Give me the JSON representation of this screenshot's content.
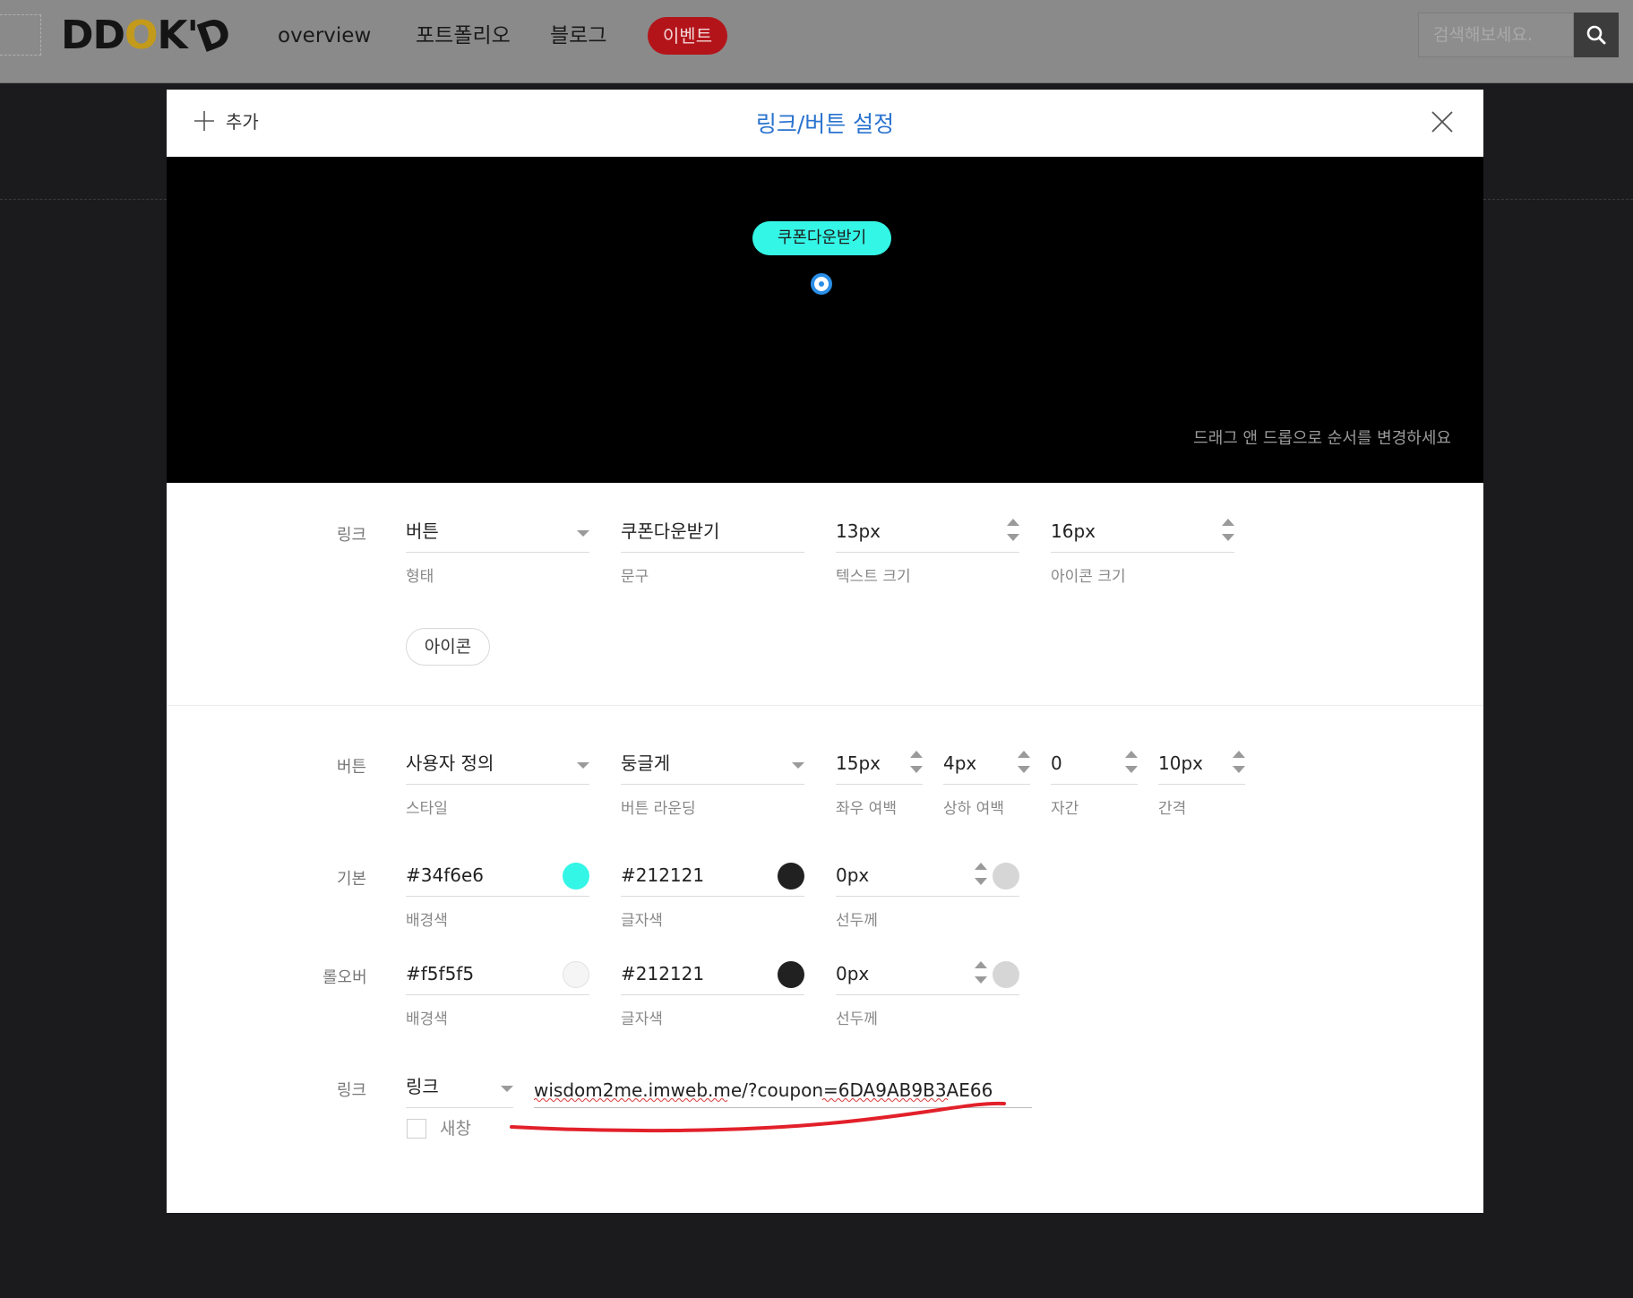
{
  "nav": {
    "logo_left": "DD",
    "logo_o": "O",
    "logo_right": "K'",
    "logo_tail": "D",
    "items": [
      "overview",
      "포트폴리오",
      "블로그"
    ],
    "badge": "이벤트",
    "search_placeholder": "검색해보세요."
  },
  "modal": {
    "add_label": "추가",
    "title": "링크/버튼 설정",
    "preview_button_text": "쿠폰다운받기",
    "preview_hint": "드래그 앤 드롭으로 순서를 변경하세요",
    "preview_button_bg": "#34f6e6"
  },
  "form": {
    "link_row": {
      "label": "링크",
      "type_value": "버튼",
      "type_label": "형태",
      "text_value": "쿠폰다운받기",
      "text_label": "문구",
      "text_size_value": "13px",
      "text_size_label": "텍스트 크기",
      "icon_size_value": "16px",
      "icon_size_label": "아이콘 크기",
      "icon_button": "아이콘"
    },
    "button_row": {
      "label": "버튼",
      "style_value": "사용자 정의",
      "style_label": "스타일",
      "rounding_value": "둥글게",
      "rounding_label": "버튼 라운딩",
      "h_padding_value": "15px",
      "h_padding_label": "좌우 여백",
      "v_padding_value": "4px",
      "v_padding_label": "상하 여백",
      "letter_spacing_value": "0",
      "letter_spacing_label": "자간",
      "gap_value": "10px",
      "gap_label": "간격"
    },
    "default_row": {
      "label": "기본",
      "bg_value": "#34f6e6",
      "bg_label": "배경색",
      "text_color_value": "#212121",
      "text_color_label": "글자색",
      "border_value": "0px",
      "border_label": "선두께",
      "bg_swatch": "#34f6e6",
      "text_swatch": "#212121",
      "border_swatch": "#d6d6d6"
    },
    "hover_row": {
      "label": "롤오버",
      "bg_value": "#f5f5f5",
      "bg_label": "배경색",
      "text_color_value": "#212121",
      "text_color_label": "글자색",
      "border_value": "0px",
      "border_label": "선두께",
      "bg_swatch": "#f5f5f5",
      "text_swatch": "#212121",
      "border_swatch": "#d6d6d6"
    },
    "link_target_row": {
      "label": "링크",
      "type_value": "링크",
      "url_value": "wisdom2me.imweb.me/?coupon=6DA9AB9B3AE66",
      "new_window_label": "새창"
    }
  },
  "icons": [
    "search-icon",
    "plus-icon",
    "close-icon",
    "chevron-down-icon",
    "spinner-icon"
  ]
}
